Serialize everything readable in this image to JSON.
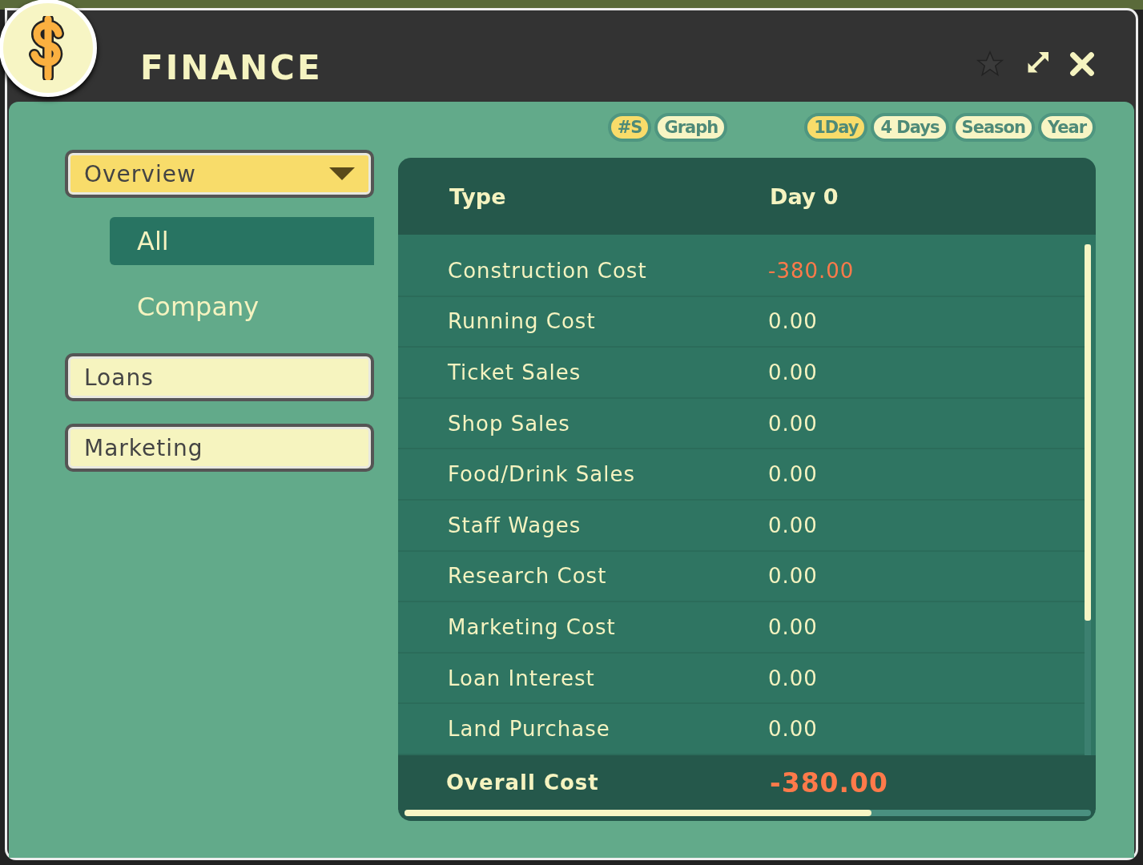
{
  "window": {
    "title": "FINANCE"
  },
  "view_toggle": [
    {
      "label": "#S",
      "selected": true
    },
    {
      "label": "Graph",
      "selected": false
    }
  ],
  "period_toggle": [
    {
      "label": "1Day",
      "selected": true
    },
    {
      "label": "4 Days",
      "selected": false
    },
    {
      "label": "Season",
      "selected": false
    },
    {
      "label": "Year",
      "selected": false
    }
  ],
  "sidebar": {
    "items": [
      {
        "label": "Overview",
        "selected": true,
        "expanded": true,
        "children": [
          {
            "label": "All",
            "selected": true
          },
          {
            "label": "Company",
            "selected": false
          }
        ]
      },
      {
        "label": "Loans",
        "selected": false
      },
      {
        "label": "Marketing",
        "selected": false
      }
    ]
  },
  "table": {
    "columns": [
      "Type",
      "Day 0"
    ],
    "rows": [
      {
        "type": "Construction Cost",
        "value": "-380.00",
        "negative": true
      },
      {
        "type": "Running Cost",
        "value": "0.00",
        "negative": false
      },
      {
        "type": "Ticket Sales",
        "value": "0.00",
        "negative": false
      },
      {
        "type": "Shop Sales",
        "value": "0.00",
        "negative": false
      },
      {
        "type": "Food/Drink Sales",
        "value": "0.00",
        "negative": false
      },
      {
        "type": "Staff Wages",
        "value": "0.00",
        "negative": false
      },
      {
        "type": "Research Cost",
        "value": "0.00",
        "negative": false
      },
      {
        "type": "Marketing Cost",
        "value": "0.00",
        "negative": false
      },
      {
        "type": "Loan Interest",
        "value": "0.00",
        "negative": false
      },
      {
        "type": "Land Purchase",
        "value": "0.00",
        "negative": false
      }
    ],
    "total": {
      "type": "Overall Cost",
      "value": "-380.00",
      "negative": true
    }
  }
}
